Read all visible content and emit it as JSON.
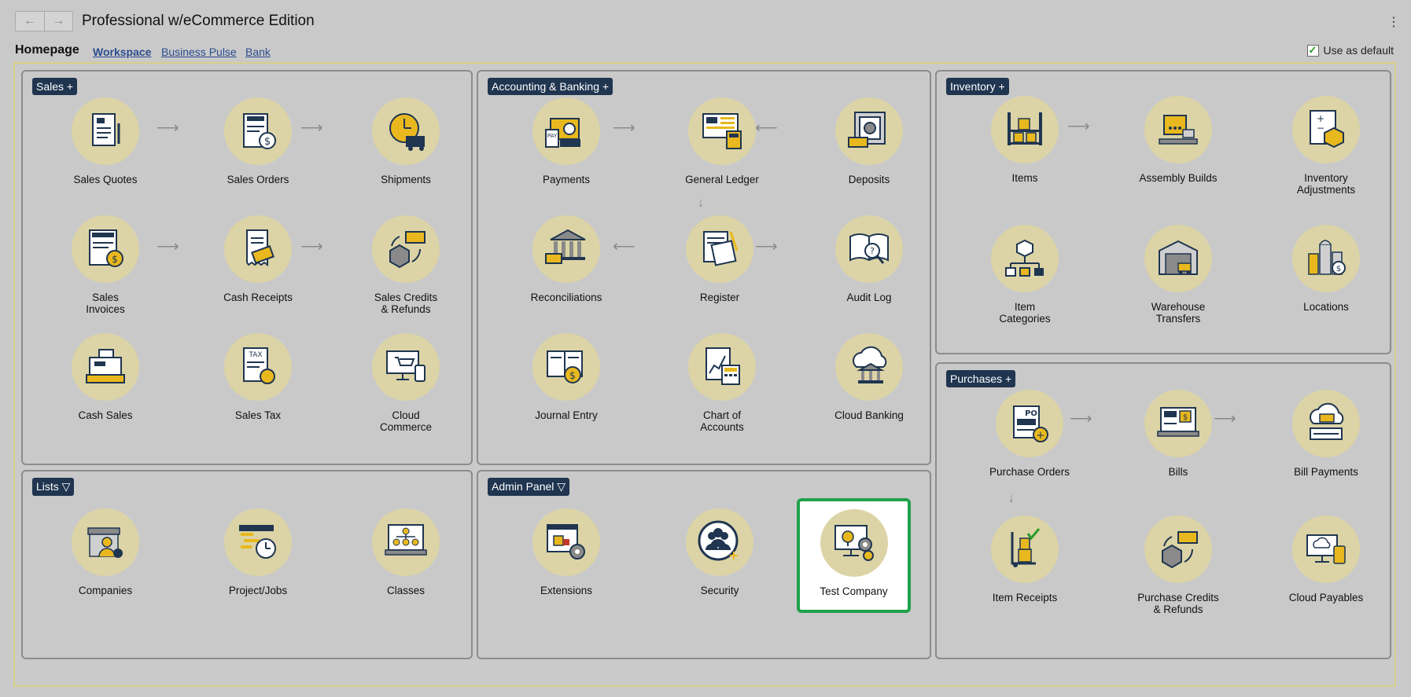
{
  "window": {
    "title": "Professional w/eCommerce Edition",
    "back_icon": "←",
    "forward_icon": "→",
    "menu_icon": "⋮"
  },
  "tabs": {
    "homepage_label": "Homepage",
    "items": [
      "Workspace",
      "Business Pulse",
      "Bank"
    ],
    "active": "Workspace"
  },
  "use_as_default": {
    "label": "Use as default",
    "checked": true,
    "check_glyph": "✓"
  },
  "panels": {
    "sales": {
      "title": "Sales +",
      "items": [
        "Sales Quotes",
        "Sales Orders",
        "Shipments",
        "Sales\nInvoices",
        "Cash Receipts",
        "Sales Credits\n& Refunds",
        "Cash Sales",
        "Sales Tax",
        "Cloud\nCommerce"
      ]
    },
    "accounting": {
      "title": "Accounting & Banking +",
      "items": [
        "Payments",
        "General Ledger",
        "Deposits",
        "Reconciliations",
        "Register",
        "Audit Log",
        "Journal Entry",
        "Chart of\nAccounts",
        "Cloud Banking"
      ]
    },
    "inventory": {
      "title": "Inventory +",
      "items": [
        "Items",
        "Assembly Builds",
        "Inventory\nAdjustments",
        "Item\nCategories",
        "Warehouse\nTransfers",
        "Locations"
      ]
    },
    "purchases": {
      "title": "Purchases +",
      "items": [
        "Purchase Orders",
        "Bills",
        "Bill Payments",
        "Item Receipts",
        "Purchase Credits\n& Refunds",
        "Cloud Payables"
      ]
    },
    "lists": {
      "title": "Lists ▽",
      "items": [
        "Companies",
        "Project/Jobs",
        "Classes"
      ]
    },
    "admin": {
      "title": "Admin Panel ▽",
      "items": [
        "Extensions",
        "Security",
        "Test Company"
      ],
      "selected": "Test Company"
    }
  },
  "colors": {
    "tile_circle": "#dcd4a6",
    "panel_title_bg": "#1f3550",
    "selected_border": "#1fa24a",
    "link": "#2a4d8f",
    "workspace_border": "#d8cf88"
  }
}
